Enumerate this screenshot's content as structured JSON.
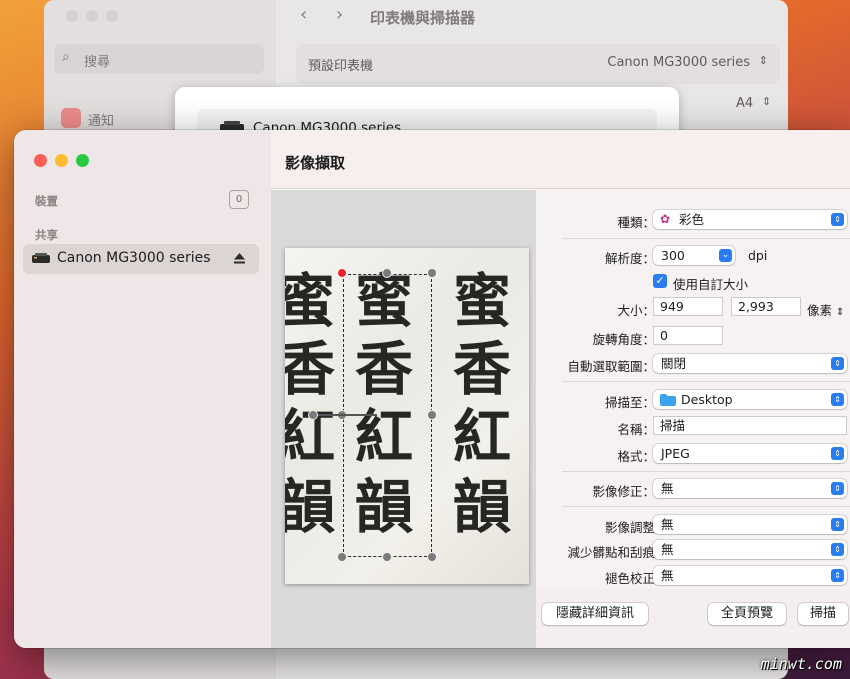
{
  "background_window": {
    "title": "印表機與掃描器",
    "search_placeholder": "搜尋",
    "sidebar_item_notifications": "通知",
    "default_printer_label": "預設印表機",
    "default_printer_value": "Canon MG3000 series",
    "paper_size_value": "A4"
  },
  "printer_sheet": {
    "printer_name": "Canon MG3000 series"
  },
  "main_window": {
    "title": "影像擷取",
    "sidebar": {
      "devices_label": "裝置",
      "devices_count": "0",
      "shared_label": "共享",
      "device_name": "Canon MG3000 series"
    },
    "preview": {
      "columns": [
        [
          "蜜",
          "香",
          "紅",
          "韻"
        ],
        [
          "蜜",
          "香",
          "紅",
          "韻"
        ],
        [
          "蜜",
          "香",
          "紅",
          "韻"
        ]
      ]
    },
    "settings": {
      "kind_label": "種類：",
      "kind_value": "彩色",
      "resolution_label": "解析度：",
      "resolution_value": "300",
      "resolution_unit": "dpi",
      "custom_size_label": "使用自訂大小",
      "custom_size_checked": true,
      "size_label": "大小：",
      "size_width": "949",
      "size_height": "2,993",
      "size_unit": "像素",
      "rotation_label": "旋轉角度：",
      "rotation_value": "0",
      "auto_select_label": "自動選取範圍：",
      "auto_select_value": "關閉",
      "scan_to_label": "掃描至：",
      "scan_to_value": "Desktop",
      "name_label": "名稱：",
      "name_value": "掃描",
      "format_label": "格式：",
      "format_value": "JPEG",
      "image_correction_label": "影像修正：",
      "image_correction_value": "無",
      "image_adjust_label": "影像調整",
      "image_adjust_value": "無",
      "dust_label": "減少髒點和刮痕",
      "dust_value": "無",
      "fade_label": "褪色校正",
      "fade_value": "無"
    },
    "buttons": {
      "hide_details": "隱藏詳細資訊",
      "overview": "全頁預覽",
      "scan": "掃描"
    }
  },
  "watermark": "minwt.com",
  "colors": {
    "accent": "#2a7cf3",
    "close": "#ff5f57",
    "minimize": "#febc2e",
    "zoom": "#28c840",
    "selection_handle_active": "#e8242a"
  }
}
